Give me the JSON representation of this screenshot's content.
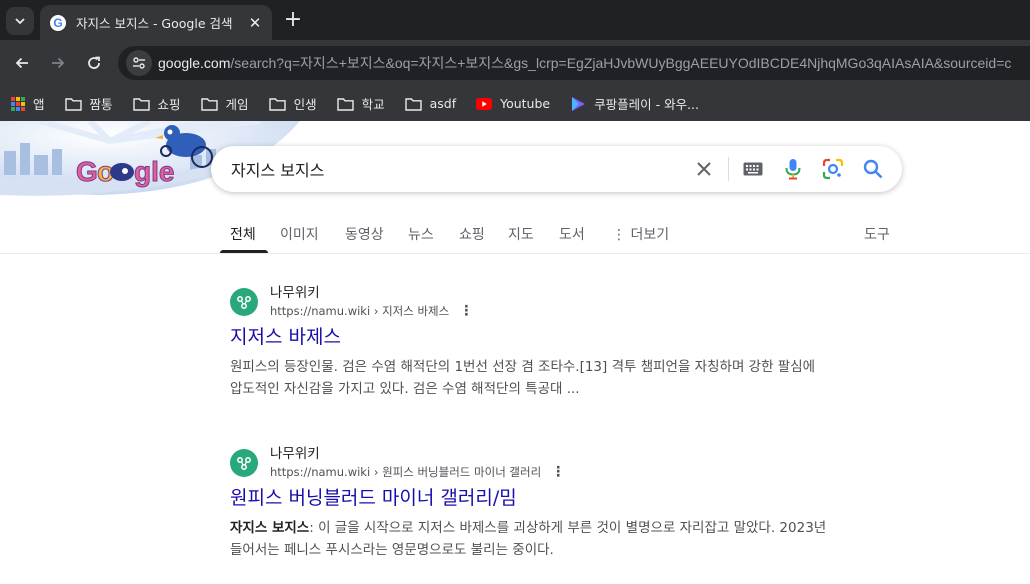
{
  "browser": {
    "tab_title": "자지스 보지스 - Google 검색",
    "url_host": "google.com",
    "url_path": "/search?q=자지스+보지스&oq=자지스+보지스&gs_lcrp=EgZjaHJvbWUyBggAEEUYOdIBCDE4NjhqMGo3qAIAsAIA&sourceid=c",
    "favicon_letter": "G"
  },
  "bookmarks": [
    {
      "label": "앱",
      "icon": "apps-grid-icon"
    },
    {
      "label": "짬통",
      "icon": "folder-icon"
    },
    {
      "label": "쇼핑",
      "icon": "folder-icon"
    },
    {
      "label": "게임",
      "icon": "folder-icon"
    },
    {
      "label": "인생",
      "icon": "folder-icon"
    },
    {
      "label": "학교",
      "icon": "folder-icon"
    },
    {
      "label": "asdf",
      "icon": "folder-icon"
    },
    {
      "label": "Youtube",
      "icon": "youtube-icon"
    },
    {
      "label": "쿠팡플레이 - 와우...",
      "icon": "coupang-play-icon"
    }
  ],
  "search": {
    "query": "자지스 보지스"
  },
  "tabs": [
    "전체",
    "이미지",
    "동영상",
    "뉴스",
    "쇼핑",
    "지도",
    "도서",
    "더보기"
  ],
  "tools_label": "도구",
  "results": [
    {
      "site_name": "나무위키",
      "url": "https://namu.wiki",
      "breadcrumb": "› 지저스 바제스",
      "title": "지저스 바제스",
      "snippet_lead": "",
      "snippet": "원피스의 등장인물. 검은 수염 해적단의 1번선 선장 겸 조타수.[13] 격투 챔피언을 자칭하며 강한 팔심에 압도적인 자신감을 가지고 있다. 검은 수염 해적단의 특공대 ..."
    },
    {
      "site_name": "나무위키",
      "url": "https://namu.wiki",
      "breadcrumb": "› 원피스 버닝블러드 마이너 갤러리",
      "title": "원피스 버닝블러드 마이너 갤러리/밈",
      "snippet_lead": "자지스 보지스",
      "snippet": ": 이 글을 시작으로 지저스 바제스를 괴상하게 부른 것이 별명으로 자리잡고 말았다. 2023년 들어서는 페니스 푸시스라는 영문명으로도 불리는 중이다."
    }
  ],
  "colors": {
    "link": "#1a0dab",
    "namu_green": "#28a87b",
    "chrome_dark": "#202124",
    "chrome_toolbar": "#35363a"
  }
}
